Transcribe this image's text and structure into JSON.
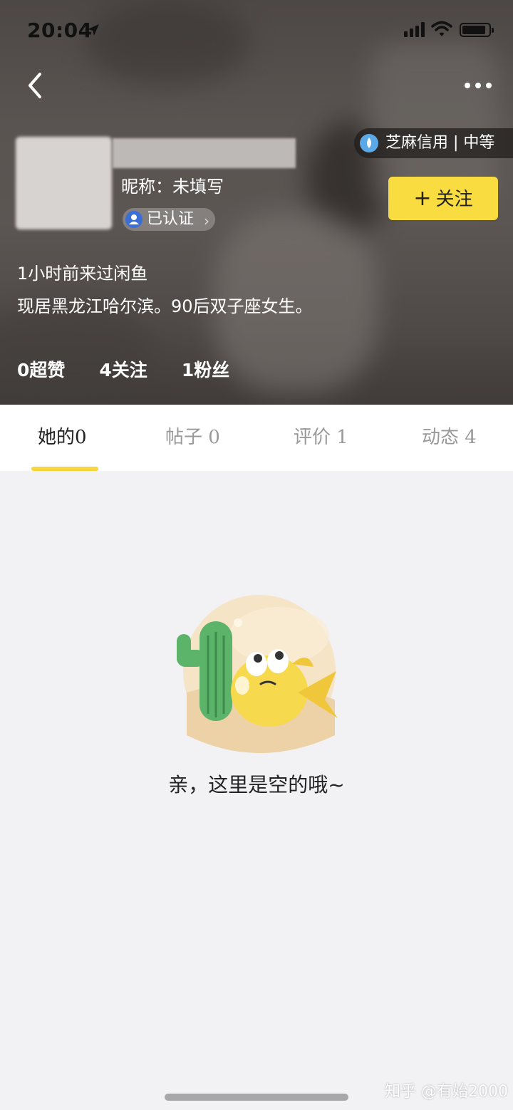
{
  "status_bar": {
    "time": "20:04",
    "icons": [
      "location-arrow-icon",
      "cellular-signal-icon",
      "wifi-icon",
      "battery-icon"
    ],
    "battery_level": 0.9
  },
  "header": {
    "nickname": "昵称：未填写",
    "verified_label": "已认证",
    "sesame_credit": "芝麻信用 | 中等",
    "follow_button": "关注",
    "last_visit": "1小时前来过闲鱼",
    "bio": "现居黑龙江哈尔滨。90后双子座女生。",
    "stats": {
      "super_likes": "0超赞",
      "following": "4关注",
      "fans": "1粉丝"
    }
  },
  "tabs": [
    {
      "label": "她的0",
      "active": true
    },
    {
      "label": "帖子 0",
      "active": false
    },
    {
      "label": "评价 1",
      "active": false
    },
    {
      "label": "动态 4",
      "active": false
    }
  ],
  "empty_state": {
    "message": "亲，这里是空的哦~",
    "illustration": "cactus-and-fish-illustration"
  },
  "watermark": "知乎 @有始2000",
  "colors": {
    "accent_yellow": "#f9dd40",
    "tab_indicator": "#f6d53f",
    "page_background": "#f2f2f4",
    "verified_blue": "#3c6fd6"
  }
}
